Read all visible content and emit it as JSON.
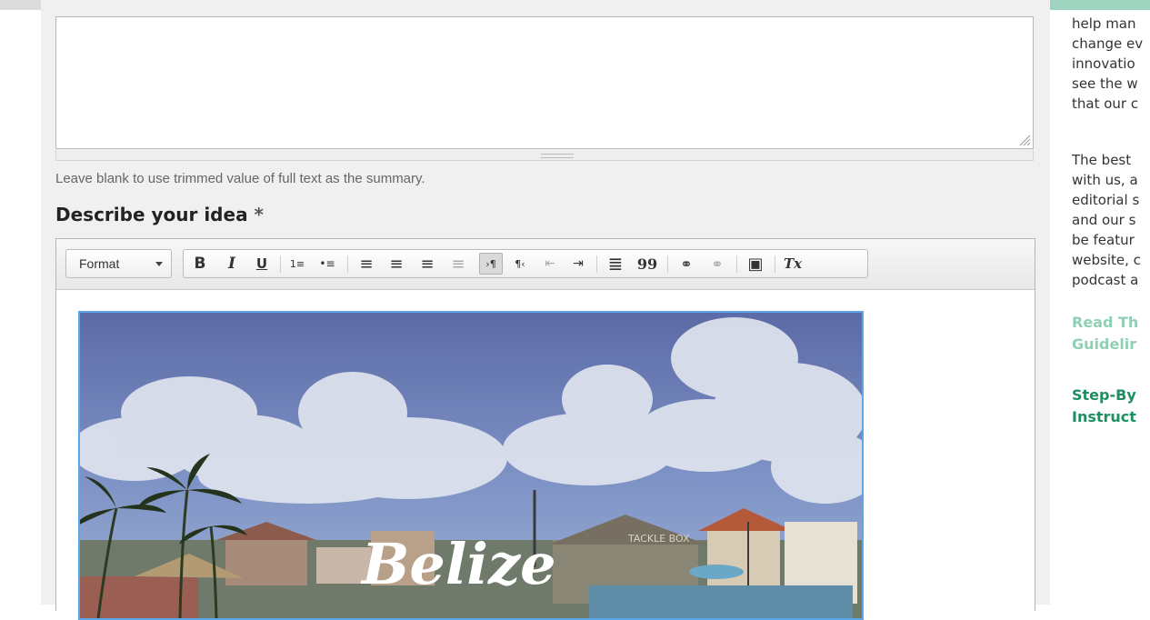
{
  "summary": {
    "value": "",
    "hint": "Leave blank to use trimmed value of full text as the summary."
  },
  "idea_field": {
    "label": "Describe your idea",
    "required_marker": "*"
  },
  "editor": {
    "format_label": "Format",
    "buttons": [
      {
        "name": "bold-button",
        "glyph": "B"
      },
      {
        "name": "italic-button",
        "glyph": "I"
      },
      {
        "name": "underline-button",
        "glyph": "U"
      },
      {
        "name": "numbered-list-button",
        "glyph": "1≡"
      },
      {
        "name": "bulleted-list-button",
        "glyph": "•≡"
      },
      {
        "name": "align-left-button",
        "glyph": "≡"
      },
      {
        "name": "align-center-button",
        "glyph": "≡"
      },
      {
        "name": "align-right-button",
        "glyph": "≡"
      },
      {
        "name": "justify-button",
        "glyph": "≡"
      },
      {
        "name": "text-direction-ltr-button",
        "glyph": "›¶"
      },
      {
        "name": "text-direction-rtl-button",
        "glyph": "¶‹"
      },
      {
        "name": "outdent-button",
        "glyph": "⇤"
      },
      {
        "name": "indent-button",
        "glyph": "⇥"
      },
      {
        "name": "horizontal-line-button",
        "glyph": "≣"
      },
      {
        "name": "blockquote-button",
        "glyph": "99"
      },
      {
        "name": "link-button",
        "glyph": "⚭"
      },
      {
        "name": "unlink-button",
        "glyph": "⚭"
      },
      {
        "name": "image-button",
        "glyph": "▣"
      },
      {
        "name": "remove-format-button",
        "glyph": "Tx"
      }
    ],
    "image_caption": "Belize",
    "image_sign": "TACKLE BOX"
  },
  "sidebar": {
    "p1_lines": [
      "help man",
      "change ev",
      "innovatio",
      "see the w",
      "that our c"
    ],
    "p2_lines": [
      "The best",
      "with us, a",
      "editorial s",
      "and our s",
      "be featur",
      "website, c",
      "podcast a"
    ],
    "link1_lines": [
      "Read Th",
      "Guidelir"
    ],
    "link2_lines": [
      "Step-By",
      "Instruct"
    ]
  },
  "colors": {
    "accent_light": "#8fd0b4",
    "accent_dark": "#1e8f62",
    "image_selection": "#5aa6e6"
  }
}
